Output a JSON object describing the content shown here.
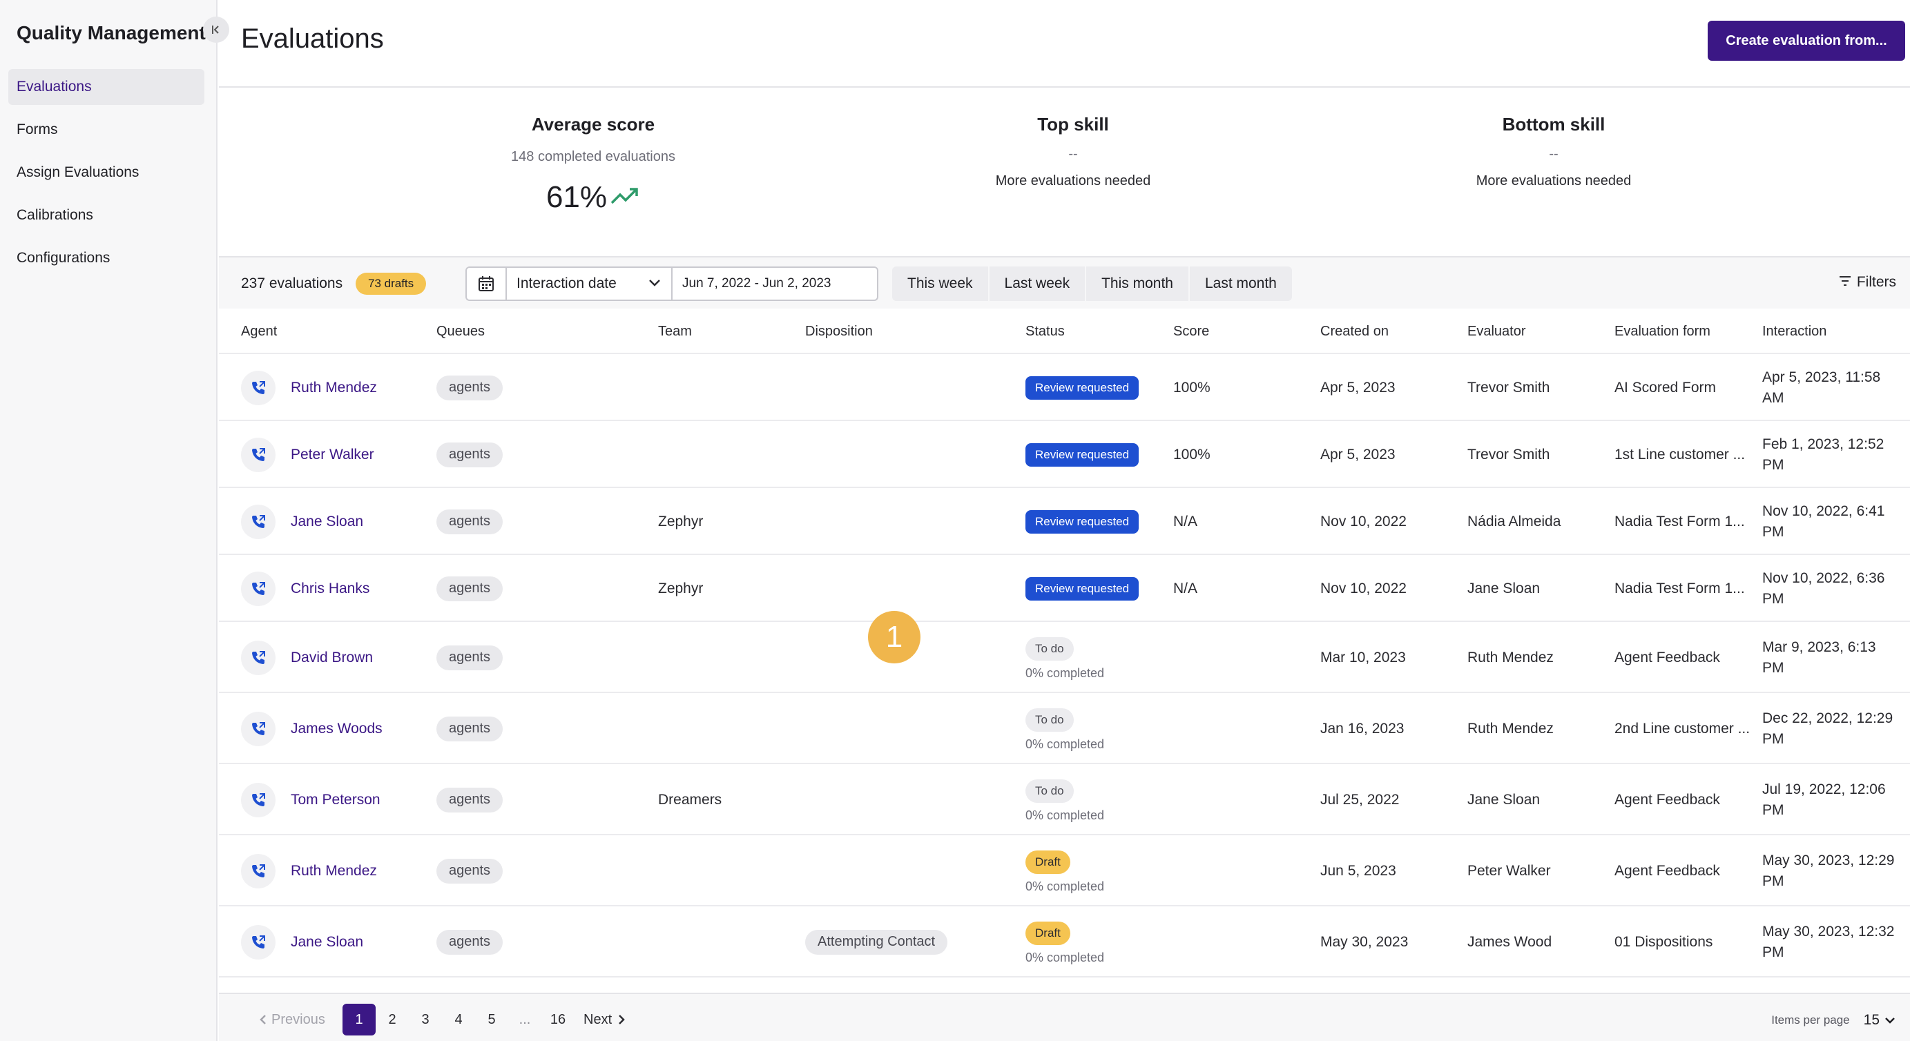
{
  "sidebar": {
    "title": "Quality Management",
    "items": [
      {
        "label": "Evaluations"
      },
      {
        "label": "Forms"
      },
      {
        "label": "Assign Evaluations"
      },
      {
        "label": "Calibrations"
      },
      {
        "label": "Configurations"
      }
    ]
  },
  "header": {
    "title": "Evaluations",
    "create_label": "Create evaluation from..."
  },
  "stats": {
    "average": {
      "title": "Average score",
      "sub": "148 completed evaluations",
      "value": "61%"
    },
    "top": {
      "title": "Top skill",
      "dash": "--",
      "note": "More evaluations needed"
    },
    "bottom": {
      "title": "Bottom skill",
      "dash": "--",
      "note": "More evaluations needed"
    }
  },
  "toolbar": {
    "count": "237 evaluations",
    "drafts": "73 drafts",
    "date_field": "Interaction date",
    "date_range": "Jun 7, 2022 - Jun 2, 2023",
    "quick": [
      "This week",
      "Last week",
      "This month",
      "Last month"
    ],
    "filters": "Filters"
  },
  "table": {
    "headers": [
      "Agent",
      "Queues",
      "Team",
      "Disposition",
      "Status",
      "Score",
      "Created on",
      "Evaluator",
      "Evaluation form",
      "Interaction"
    ],
    "rows": [
      {
        "agent": "Ruth Mendez",
        "queue": "agents",
        "team": "",
        "disposition": "",
        "status": "Review requested",
        "pct": "",
        "score": "100%",
        "created": "Apr 5, 2023",
        "evaluator": "Trevor Smith",
        "form": "AI Scored Form",
        "interaction_1": "Apr 5, 2023, 11:58",
        "interaction_2": "AM"
      },
      {
        "agent": "Peter Walker",
        "queue": "agents",
        "team": "",
        "disposition": "",
        "status": "Review requested",
        "pct": "",
        "score": "100%",
        "created": "Apr 5, 2023",
        "evaluator": "Trevor Smith",
        "form": "1st Line customer ...",
        "interaction_1": "Feb 1, 2023, 12:52",
        "interaction_2": "PM"
      },
      {
        "agent": "Jane Sloan",
        "queue": "agents",
        "team": "Zephyr",
        "disposition": "",
        "status": "Review requested",
        "pct": "",
        "score": "N/A",
        "created": "Nov 10, 2022",
        "evaluator": "Nádia Almeida",
        "form": "Nadia Test Form 1...",
        "interaction_1": "Nov 10, 2022, 6:41",
        "interaction_2": "PM"
      },
      {
        "agent": "Chris Hanks",
        "queue": "agents",
        "team": "Zephyr",
        "disposition": "",
        "status": "Review requested",
        "pct": "",
        "score": "N/A",
        "created": "Nov 10, 2022",
        "evaluator": "Jane Sloan",
        "form": "Nadia Test Form 1...",
        "interaction_1": "Nov 10, 2022, 6:36",
        "interaction_2": "PM"
      },
      {
        "agent": "David Brown",
        "queue": "agents",
        "team": "",
        "disposition": "",
        "status": "To do",
        "pct": "0% completed",
        "score": "",
        "created": "Mar 10, 2023",
        "evaluator": "Ruth Mendez",
        "form": "Agent Feedback",
        "interaction_1": "Mar 9, 2023, 6:13",
        "interaction_2": "PM"
      },
      {
        "agent": "James Woods",
        "queue": "agents",
        "team": "",
        "disposition": "",
        "status": "To do",
        "pct": "0% completed",
        "score": "",
        "created": "Jan 16, 2023",
        "evaluator": "Ruth Mendez",
        "form": "2nd Line customer ...",
        "interaction_1": "Dec 22, 2022, 12:29",
        "interaction_2": "PM"
      },
      {
        "agent": "Tom Peterson",
        "queue": "agents",
        "team": "Dreamers",
        "disposition": "",
        "status": "To do",
        "pct": "0% completed",
        "score": "",
        "created": "Jul 25, 2022",
        "evaluator": "Jane Sloan",
        "form": "Agent Feedback",
        "interaction_1": "Jul 19, 2022, 12:06",
        "interaction_2": "PM"
      },
      {
        "agent": "Ruth Mendez",
        "queue": "agents",
        "team": "",
        "disposition": "",
        "status": "Draft",
        "pct": "0% completed",
        "score": "",
        "created": "Jun 5, 2023",
        "evaluator": "Peter Walker",
        "form": "Agent Feedback",
        "interaction_1": "May 30, 2023, 12:29",
        "interaction_2": "PM"
      },
      {
        "agent": "Jane Sloan",
        "queue": "agents",
        "team": "",
        "disposition": "Attempting Contact",
        "status": "Draft",
        "pct": "0% completed",
        "score": "",
        "created": "May 30, 2023",
        "evaluator": "James Wood",
        "form": "01 Dispositions",
        "interaction_1": "May 30, 2023, 12:32",
        "interaction_2": "PM"
      }
    ]
  },
  "marker": "1",
  "pagination": {
    "prev": "Previous",
    "pages": [
      "1",
      "2",
      "3",
      "4",
      "5",
      "...",
      "16"
    ],
    "next": "Next",
    "items_label": "Items per page",
    "items_value": "15"
  },
  "colors": {
    "brand": "#3b1785",
    "review": "#1e4fd1",
    "draft": "#f5c451",
    "trend": "#2e9b6a"
  }
}
